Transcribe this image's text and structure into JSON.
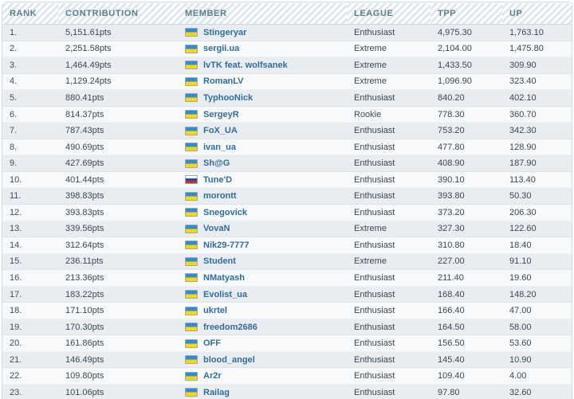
{
  "table": {
    "columns": [
      {
        "key": "rank",
        "label": "RANK"
      },
      {
        "key": "contrib",
        "label": "CONTRIBUTION"
      },
      {
        "key": "member",
        "label": "MEMBER"
      },
      {
        "key": "league",
        "label": "LEAGUE"
      },
      {
        "key": "tpp",
        "label": "TPP"
      },
      {
        "key": "up",
        "label": "UP"
      }
    ],
    "rows": [
      {
        "rank": "1.",
        "contrib": "5,151.61pts",
        "flag": "ua",
        "flag_label": "flag-ukraine",
        "member": "Stingeryar",
        "league": "Enthusiast",
        "tpp": "4,975.30",
        "up": "1,763.10"
      },
      {
        "rank": "2.",
        "contrib": "2,251.58pts",
        "flag": "ua",
        "flag_label": "flag-ukraine",
        "member": "sergii.ua",
        "league": "Extreme",
        "tpp": "2,104.00",
        "up": "1,475.80"
      },
      {
        "rank": "3.",
        "contrib": "1,464.49pts",
        "flag": "ua",
        "flag_label": "flag-ukraine",
        "member": "lvTK feat. wolfsanek",
        "league": "Extreme",
        "tpp": "1,433.50",
        "up": "309.90"
      },
      {
        "rank": "4.",
        "contrib": "1,129.24pts",
        "flag": "ua",
        "flag_label": "flag-ukraine",
        "member": "RomanLV",
        "league": "Extreme",
        "tpp": "1,096.90",
        "up": "323.40"
      },
      {
        "rank": "5.",
        "contrib": "880.41pts",
        "flag": "ua",
        "flag_label": "flag-ukraine",
        "member": "TyphooNick",
        "league": "Enthusiast",
        "tpp": "840.20",
        "up": "402.10"
      },
      {
        "rank": "6.",
        "contrib": "814.37pts",
        "flag": "ua",
        "flag_label": "flag-ukraine",
        "member": "SergeyR",
        "league": "Rookie",
        "tpp": "778.30",
        "up": "360.70"
      },
      {
        "rank": "7.",
        "contrib": "787.43pts",
        "flag": "ua",
        "flag_label": "flag-ukraine",
        "member": "FoX_UA",
        "league": "Enthusiast",
        "tpp": "753.20",
        "up": "342.30"
      },
      {
        "rank": "8.",
        "contrib": "490.69pts",
        "flag": "ua",
        "flag_label": "flag-ukraine",
        "member": "ivan_ua",
        "league": "Enthusiast",
        "tpp": "477.80",
        "up": "128.90"
      },
      {
        "rank": "9.",
        "contrib": "427.69pts",
        "flag": "ua",
        "flag_label": "flag-ukraine",
        "member": "Sh@G",
        "league": "Enthusiast",
        "tpp": "408.90",
        "up": "187.90"
      },
      {
        "rank": "10.",
        "contrib": "401.44pts",
        "flag": "ru",
        "flag_label": "flag-russia",
        "member": "Tune'D",
        "league": "Enthusiast",
        "tpp": "390.10",
        "up": "113.40"
      },
      {
        "rank": "11.",
        "contrib": "398.83pts",
        "flag": "ua",
        "flag_label": "flag-ukraine",
        "member": "morontt",
        "league": "Enthusiast",
        "tpp": "393.80",
        "up": "50.30"
      },
      {
        "rank": "12.",
        "contrib": "393.83pts",
        "flag": "ua",
        "flag_label": "flag-ukraine",
        "member": "Snegovick",
        "league": "Enthusiast",
        "tpp": "373.20",
        "up": "206.30"
      },
      {
        "rank": "13.",
        "contrib": "339.56pts",
        "flag": "ua",
        "flag_label": "flag-ukraine",
        "member": "VovaN",
        "league": "Extreme",
        "tpp": "327.30",
        "up": "122.60"
      },
      {
        "rank": "14.",
        "contrib": "312.64pts",
        "flag": "ua",
        "flag_label": "flag-ukraine",
        "member": "Nik29-7777",
        "league": "Enthusiast",
        "tpp": "310.80",
        "up": "18.40"
      },
      {
        "rank": "15.",
        "contrib": "236.11pts",
        "flag": "ua",
        "flag_label": "flag-ukraine",
        "member": "Student",
        "league": "Extreme",
        "tpp": "227.00",
        "up": "91.10"
      },
      {
        "rank": "16.",
        "contrib": "213.36pts",
        "flag": "ua",
        "flag_label": "flag-ukraine",
        "member": "NMatyash",
        "league": "Enthusiast",
        "tpp": "211.40",
        "up": "19.60"
      },
      {
        "rank": "17.",
        "contrib": "183.22pts",
        "flag": "ua",
        "flag_label": "flag-ukraine",
        "member": "Evolist_ua",
        "league": "Enthusiast",
        "tpp": "168.40",
        "up": "148.20"
      },
      {
        "rank": "18.",
        "contrib": "171.10pts",
        "flag": "ua",
        "flag_label": "flag-ukraine",
        "member": "ukrtel",
        "league": "Enthusiast",
        "tpp": "166.40",
        "up": "47.00"
      },
      {
        "rank": "19.",
        "contrib": "170.30pts",
        "flag": "ua",
        "flag_label": "flag-ukraine",
        "member": "freedom2686",
        "league": "Enthusiast",
        "tpp": "164.50",
        "up": "58.00"
      },
      {
        "rank": "20.",
        "contrib": "161.86pts",
        "flag": "ua",
        "flag_label": "flag-ukraine",
        "member": "OFF",
        "league": "Enthusiast",
        "tpp": "156.50",
        "up": "53.60"
      },
      {
        "rank": "21.",
        "contrib": "146.49pts",
        "flag": "ua",
        "flag_label": "flag-ukraine",
        "member": "blood_angel",
        "league": "Enthusiast",
        "tpp": "145.40",
        "up": "10.90"
      },
      {
        "rank": "22.",
        "contrib": "109.80pts",
        "flag": "ua",
        "flag_label": "flag-ukraine",
        "member": "Ar2r",
        "league": "Enthusiast",
        "tpp": "109.40",
        "up": "4.00"
      },
      {
        "rank": "23.",
        "contrib": "101.06pts",
        "flag": "ua",
        "flag_label": "flag-ukraine",
        "member": "Railag",
        "league": "Enthusiast",
        "tpp": "97.80",
        "up": "32.60"
      }
    ]
  },
  "colors": {
    "header_text": "#5d7f8a",
    "link": "#2f6d9e",
    "row_odd": "#e9edf1",
    "row_even": "#f7f9fa",
    "border": "#d6dde2"
  }
}
